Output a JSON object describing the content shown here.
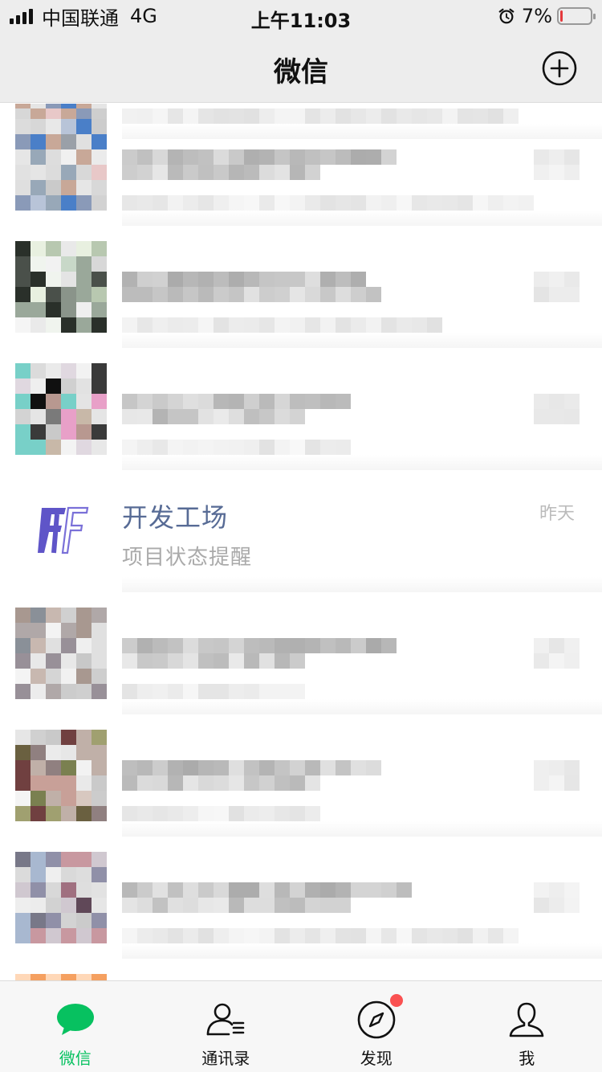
{
  "status_bar": {
    "carrier": "中国联通",
    "network": "4G",
    "time": "上午11:03",
    "battery_percent": "7%",
    "battery_level": 0.07
  },
  "nav": {
    "title": "微信"
  },
  "chat": {
    "featured": {
      "name": "开发工场",
      "preview": "项目状态提醒",
      "time": "昨天"
    }
  },
  "tabs": [
    {
      "label": "微信",
      "icon": "chat-bubble-icon",
      "active": true
    },
    {
      "label": "通讯录",
      "icon": "contacts-icon",
      "active": false
    },
    {
      "label": "发现",
      "icon": "compass-icon",
      "active": false,
      "badge": "dot"
    },
    {
      "label": "我",
      "icon": "person-icon",
      "active": false
    }
  ],
  "colors": {
    "accent": "#07c160",
    "name_link": "#576b95",
    "badge": "#fa5151",
    "bar_bg": "#ededed"
  }
}
